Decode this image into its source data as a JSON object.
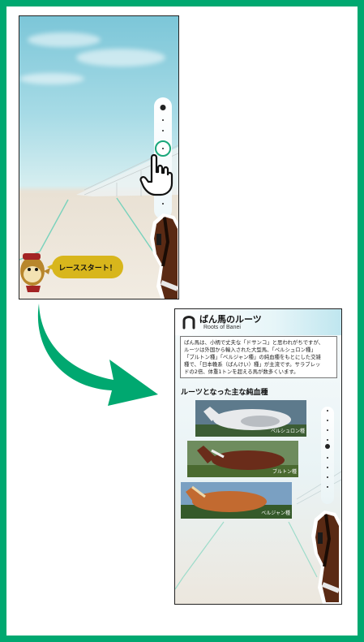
{
  "screen1": {
    "speech_text": "レーススタート！"
  },
  "screen2": {
    "title": "ばん馬のルーツ",
    "subtitle": "Roots of Banei",
    "description_lines": [
      "ばん馬は、小柄で丈夫な「ドサンコ」と思われがちですが、",
      "ルーツは外国から輸入された大型馬、「ペルシュロン種」",
      "「ブルトン種」「ベルジャン種」の純血種をもとにした交雑",
      "種で、「日本輓系（ばんけい）種」が主流です。サラブレッ",
      "ドの2倍、体重1トンを超える馬が数多くいます。"
    ],
    "section_heading": "ルーツとなった主な純血種",
    "horses": [
      {
        "label": "ペルシュロン種"
      },
      {
        "label": "ブルトン種"
      },
      {
        "label": "ベルジャン種"
      }
    ]
  },
  "colors": {
    "frame": "#00a870",
    "arrow": "#00a870",
    "speech_bubble": "#d8b61c",
    "progress_ring": "#1aa77a"
  },
  "icons": {
    "tap": "pointing-hand-icon",
    "logo": "horseshoe-icon"
  }
}
